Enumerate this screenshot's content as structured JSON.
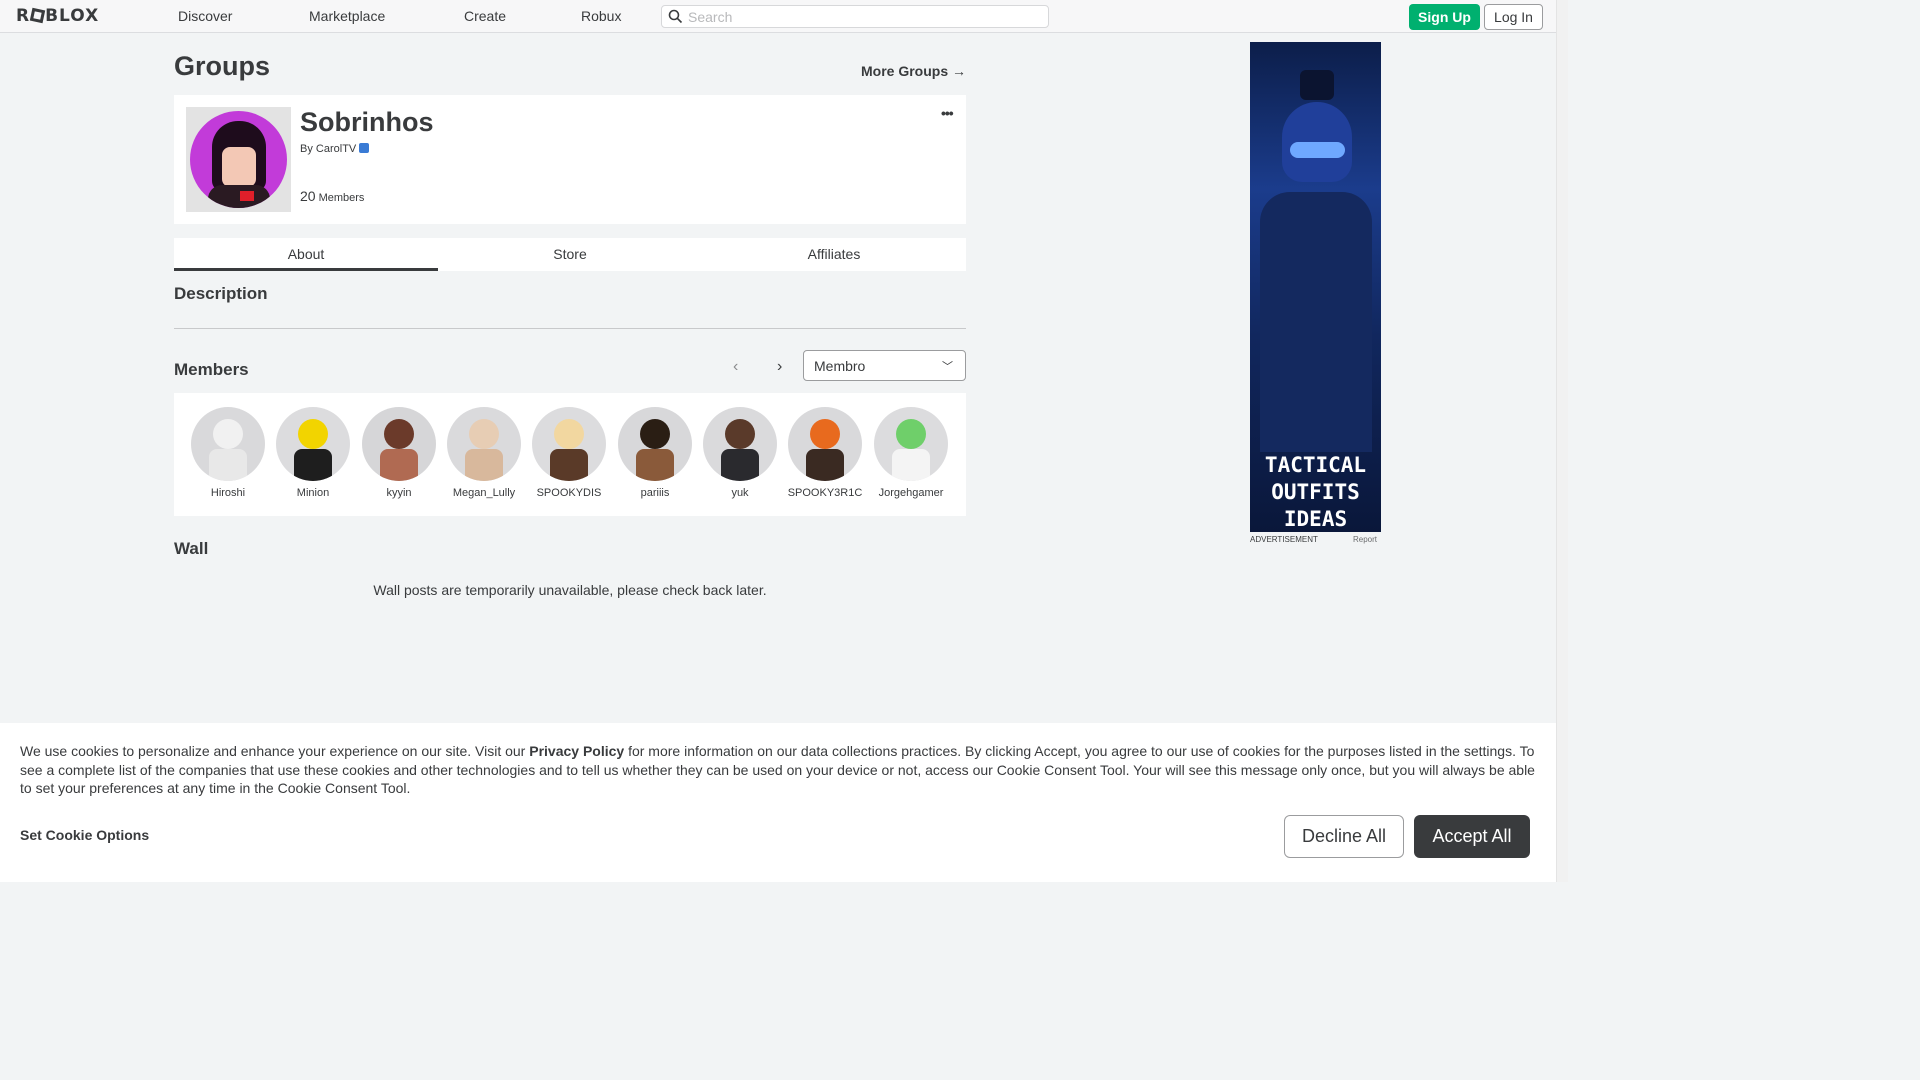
{
  "nav": {
    "logo": "ROBLOX",
    "links": [
      "Discover",
      "Marketplace",
      "Create",
      "Robux"
    ],
    "search_placeholder": "Search",
    "signup": "Sign Up",
    "login": "Log In"
  },
  "page": {
    "title": "Groups",
    "more_groups": "More Groups →"
  },
  "group": {
    "name": "Sobrinhos",
    "by_prefix": "By",
    "owner": "CarolTV",
    "member_count": "20",
    "member_label": "Members",
    "menu": "•••"
  },
  "tabs": [
    "About",
    "Store",
    "Affiliates"
  ],
  "sections": {
    "description": "Description",
    "members": "Members",
    "wall": "Wall"
  },
  "members": {
    "prev": "‹",
    "next": "›",
    "role_selected": "Membro",
    "list": [
      {
        "name": "Hiroshi",
        "head": "#f1f1f1",
        "torso": "#e8e8e8",
        "bg": "#d9d9db"
      },
      {
        "name": "Minion",
        "head": "#f2d400",
        "torso": "#1e1e1e",
        "bg": "#dcdcde"
      },
      {
        "name": "kyyin",
        "head": "#6b3a2a",
        "torso": "#b06a52",
        "bg": "#d6d6d8"
      },
      {
        "name": "Megan_Lully",
        "head": "#e7cdb4",
        "torso": "#d8b89c",
        "bg": "#dadadc"
      },
      {
        "name": "SPOOKYDIS",
        "head": "#f2d7a0",
        "torso": "#5a3a28",
        "bg": "#dcdcde"
      },
      {
        "name": "pariiis",
        "head": "#2a1e14",
        "torso": "#8a5a3a",
        "bg": "#d8d8da"
      },
      {
        "name": "yuk",
        "head": "#5a3a2a",
        "torso": "#2a2a2e",
        "bg": "#dadadc"
      },
      {
        "name": "SPOOKY3R1C",
        "head": "#e86a1e",
        "torso": "#3a2a22",
        "bg": "#d9d9db"
      },
      {
        "name": "Jorgehgamer",
        "head": "#6fcf6a",
        "torso": "#f4f4f4",
        "bg": "#dcdcde"
      }
    ]
  },
  "wall": {
    "message": "Wall posts are temporarily unavailable, please check back later."
  },
  "ad": {
    "text_line1": "TACTICAL",
    "text_line2": "OUTFITS",
    "text_line3": "IDEAS",
    "label": "ADVERTISEMENT",
    "report": "Report"
  },
  "cookie": {
    "text_before": "We use cookies to personalize and enhance your experience on our site. Visit our ",
    "privacy_link": "Privacy Policy",
    "text_after": " for more information on our data collections practices. By clicking Accept, you agree to our use of cookies for the purposes listed in the settings. To see a complete list of the companies that use these cookies and other technologies and to tell us whether they can be used on your device or not, access our Cookie Consent Tool. Your will see this message only once, but you will always be able to set your preferences at any time in the Cookie Consent Tool.",
    "options": "Set Cookie Options",
    "decline": "Decline All",
    "accept": "Accept All"
  },
  "colors": {
    "accent_green": "#00b06f",
    "text_dark": "#393b3d",
    "page_bg": "#f2f4f5"
  }
}
